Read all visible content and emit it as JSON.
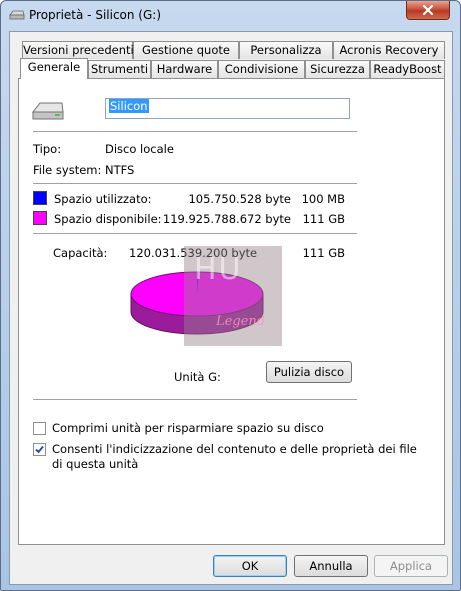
{
  "window": {
    "title": "Proprietà - Silicon (G:)"
  },
  "tabs_row1": [
    {
      "label": "Versioni precedenti"
    },
    {
      "label": "Gestione quote"
    },
    {
      "label": "Personalizza"
    },
    {
      "label": "Acronis Recovery"
    }
  ],
  "tabs_row2": [
    {
      "label": "Generale"
    },
    {
      "label": "Strumenti"
    },
    {
      "label": "Hardware"
    },
    {
      "label": "Condivisione"
    },
    {
      "label": "Sicurezza"
    },
    {
      "label": "ReadyBoost"
    }
  ],
  "general": {
    "drive_name": "Silicon",
    "type_label": "Tipo:",
    "type_value": "Disco locale",
    "fs_label": "File system:",
    "fs_value": "NTFS",
    "used_label": "Spazio utilizzato:",
    "used_bytes": "105.750.528 byte",
    "used_size": "100 MB",
    "free_label": "Spazio disponibile:",
    "free_bytes": "119.925.788.672 byte",
    "free_size": "111 GB",
    "capacity_label": "Capacità:",
    "capacity_bytes": "120.031.539.200 byte",
    "capacity_size": "111 GB",
    "drive_label": "Unità G:",
    "cleanup_button": "Pulizia disco",
    "compress_label": "Comprimi unità per risparmiare spazio su disco",
    "index_label_line1": "Consenti l'indicizzazione del contenuto e delle proprietà dei file",
    "index_label_line2": "di questa unità",
    "compress_checked": false,
    "index_checked": true
  },
  "colors": {
    "used": "#0000ff",
    "free": "#ff00ff"
  },
  "watermark": {
    "text": "HU",
    "sub": "Legend"
  },
  "buttons": {
    "ok": "OK",
    "cancel": "Annulla",
    "apply": "Applica"
  }
}
